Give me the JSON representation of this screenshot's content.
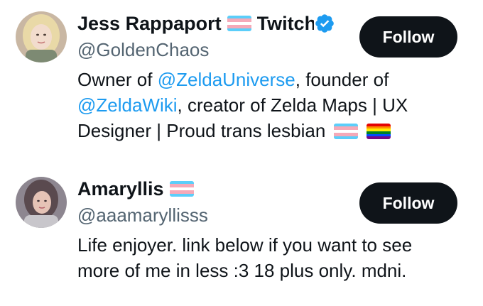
{
  "users": [
    {
      "display_name": "Jess Rappaport",
      "name_suffix": "Twitch",
      "verified": true,
      "handle": "@GoldenChaos",
      "bio": {
        "prefix": "Owner of ",
        "mention1": "@ZeldaUniverse",
        "mid1": ", founder of ",
        "mention2": "@ZeldaWiki",
        "mid2": ", creator of Zelda Maps | UX Designer | Proud trans lesbian"
      },
      "flags": [
        "trans-flag",
        "rainbow-flag"
      ],
      "follow_label": "Follow"
    },
    {
      "display_name": "Amaryllis",
      "verified": false,
      "handle": "@aaamaryllisss",
      "bio": {
        "text": "Life enjoyer. link below if you want to see more of me in less :3 18 plus only. mdni."
      },
      "flags": [
        "trans-flag"
      ],
      "follow_label": "Follow"
    }
  ],
  "colors": {
    "text": "#0f1419",
    "secondary": "#536471",
    "link": "#1d9bf0",
    "button_bg": "#0f1419",
    "button_text": "#ffffff"
  }
}
